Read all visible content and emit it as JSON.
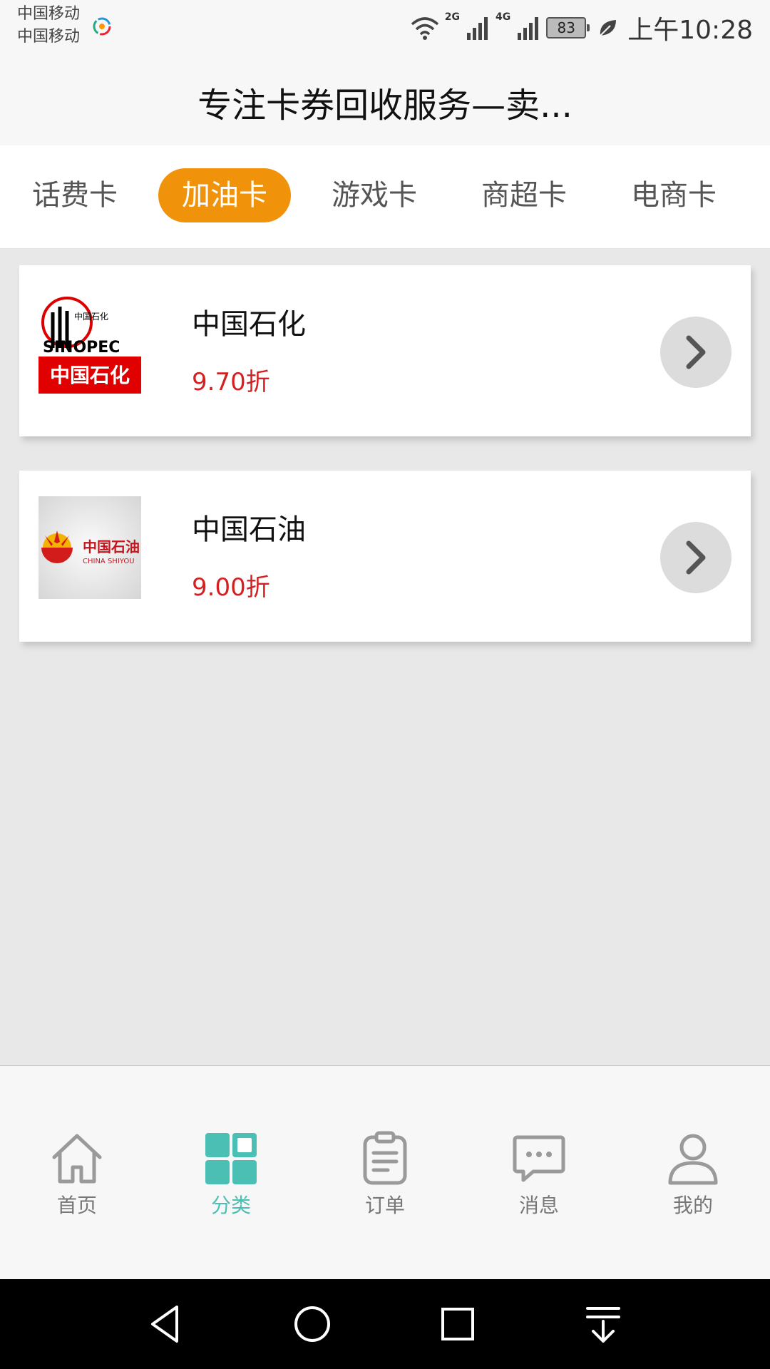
{
  "status_bar": {
    "carrier_1": "中国移动",
    "carrier_2": "中国移动",
    "net_1": "2G",
    "net_2": "4G",
    "battery": "83",
    "time": "上午10:28"
  },
  "header": {
    "title": "专注卡券回收服务—卖..."
  },
  "tabs": [
    {
      "label": "话费卡",
      "active": false
    },
    {
      "label": "加油卡",
      "active": true
    },
    {
      "label": "游戏卡",
      "active": false
    },
    {
      "label": "商超卡",
      "active": false
    },
    {
      "label": "电商卡",
      "active": false
    }
  ],
  "cards": [
    {
      "name": "中国石化",
      "discount": "9.70折",
      "logo_icon": "sinopec-logo",
      "logo_text": "中国石化",
      "logo_brand": "SINOPEC"
    },
    {
      "name": "中国石油",
      "discount": "9.00折",
      "logo_icon": "petrochina-logo",
      "logo_text": "中国石油",
      "logo_sub": "CHINA SHIYOU"
    }
  ],
  "bottom_nav": [
    {
      "label": "首页",
      "icon": "home-icon",
      "active": false
    },
    {
      "label": "分类",
      "icon": "category-icon",
      "active": true
    },
    {
      "label": "订单",
      "icon": "order-icon",
      "active": false
    },
    {
      "label": "消息",
      "icon": "message-icon",
      "active": false
    },
    {
      "label": "我的",
      "icon": "profile-icon",
      "active": false
    }
  ],
  "colors": {
    "accent_orange": "#f0920a",
    "active_teal": "#4bbfb4",
    "discount_red": "#d42020",
    "background": "#e8e8e8"
  }
}
